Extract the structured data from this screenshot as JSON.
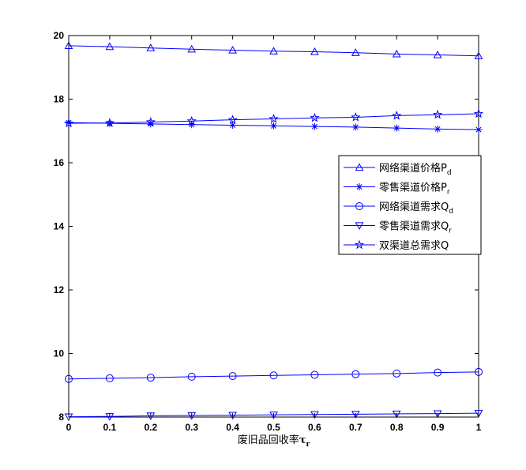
{
  "chart_data": {
    "type": "line",
    "title": "",
    "xlabel": "废旧品回收率",
    "xlabel_symbol": "τ",
    "xlabel_symbol_sub": "r",
    "ylabel": "",
    "xlim": [
      0,
      1
    ],
    "ylim": [
      8,
      20
    ],
    "x": [
      0,
      0.1,
      0.2,
      0.3,
      0.4,
      0.5,
      0.6,
      0.7,
      0.8,
      0.9,
      1
    ],
    "x_ticks": [
      "0",
      "0.1",
      "0.2",
      "0.3",
      "0.4",
      "0.5",
      "0.6",
      "0.7",
      "0.8",
      "0.9",
      "1"
    ],
    "y_ticks": [
      "8",
      "10",
      "12",
      "14",
      "16",
      "18",
      "20"
    ],
    "grid": false,
    "legend_position": "right-upper-inside",
    "line_color": "#0000ff",
    "series": [
      {
        "name": "网络渠道价格P",
        "name_sub": "d",
        "marker": "triangle-up",
        "values": [
          19.68,
          19.65,
          19.61,
          19.57,
          19.54,
          19.51,
          19.49,
          19.46,
          19.42,
          19.39,
          19.36
        ]
      },
      {
        "name": "零售渠道价格P",
        "name_sub": "r",
        "marker": "asterisk",
        "values": [
          17.26,
          17.24,
          17.22,
          17.2,
          17.18,
          17.16,
          17.14,
          17.12,
          17.09,
          17.06,
          17.04
        ]
      },
      {
        "name": "网络渠道需求Q",
        "name_sub": "d",
        "marker": "circle",
        "values": [
          9.2,
          9.22,
          9.24,
          9.27,
          9.29,
          9.31,
          9.33,
          9.35,
          9.37,
          9.4,
          9.42
        ]
      },
      {
        "name": "零售渠道需求Q",
        "name_sub": "r",
        "marker": "triangle-down",
        "values": [
          8.01,
          8.02,
          8.04,
          8.05,
          8.06,
          8.07,
          8.08,
          8.09,
          8.1,
          8.11,
          8.12
        ]
      },
      {
        "name": "双渠道总需求Q",
        "name_sub": "",
        "marker": "pentagram",
        "values": [
          17.24,
          17.25,
          17.28,
          17.31,
          17.35,
          17.38,
          17.41,
          17.43,
          17.48,
          17.51,
          17.54
        ]
      }
    ]
  }
}
